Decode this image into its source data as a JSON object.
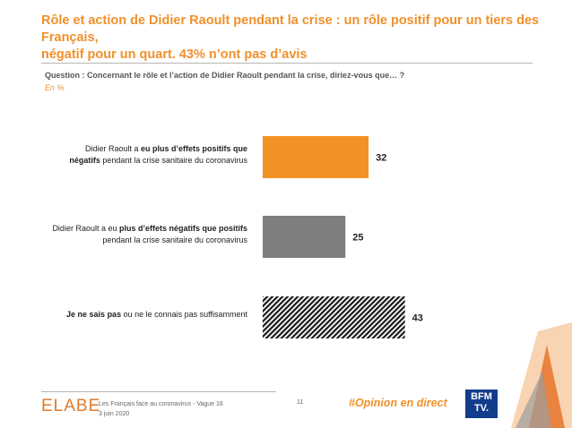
{
  "title": {
    "line1": "Rôle et action de Didier Raoult pendant la crise : un rôle positif pour un tiers des Français,",
    "line2": "négatif pour un quart. 43% n’ont pas d’avis"
  },
  "question": "Question : Concernant le rôle et l’action de Didier Raoult pendant la crise, diriez-vous que… ?",
  "unit": "En  %",
  "labels": [
    {
      "line1_pre": "Didier Raoult a ",
      "line1_bold": "eu plus d’effets positifs que",
      "line2_bold": "négatifs",
      "line2_post": " pendant la crise sanitaire du coronavirus"
    },
    {
      "line1_pre": "Didier Raoult a eu ",
      "line1_bold": "plus d’effets négatifs que positifs",
      "line2_post": "pendant la crise sanitaire du coronavirus"
    },
    {
      "bold": "Je ne sais pas",
      "post": " ou ne le connais pas suffisamment"
    }
  ],
  "chart_data": {
    "type": "bar",
    "orientation": "horizontal",
    "categories": [
      "Didier Raoult a eu plus d’effets positifs que négatifs pendant la crise sanitaire du coronavirus",
      "Didier Raoult a eu plus d’effets négatifs que positifs pendant la crise sanitaire du coronavirus",
      "Je ne sais pas ou ne le connais pas suffisamment"
    ],
    "values": [
      32,
      25,
      43
    ],
    "colors": [
      "#f39224",
      "#7f7f7f",
      "hatched-black"
    ],
    "xlim": [
      0,
      100
    ],
    "grid": false,
    "value_labels": [
      "32",
      "25",
      "43"
    ]
  },
  "footer": {
    "logo": "ELABE",
    "source_line1": "Les Français face au coronavirus - Vague 16",
    "source_line2": "3 juin 2020",
    "page": "11",
    "hashtag": "#Opinion en direct",
    "bfm_line1": "BFM",
    "bfm_line2": "TV."
  }
}
